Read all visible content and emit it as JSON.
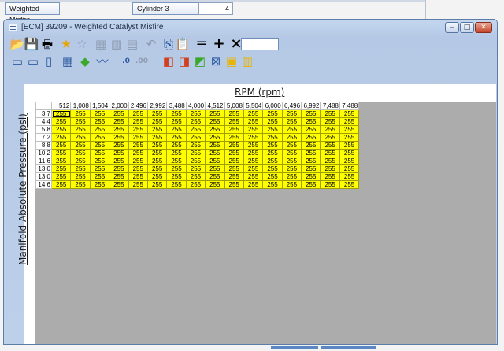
{
  "background": {
    "button_label": "Weighted Misfire",
    "cylinder_label": "Cylinder 3",
    "cylinder_value": "4"
  },
  "window": {
    "title": "[ECM] 39209 - Weighted Catalyst Misfire",
    "controls": {
      "minimize": "–",
      "maximize": "□",
      "close": "✕"
    }
  },
  "toolbar1": [
    {
      "name": "open-icon",
      "glyph": "📂",
      "disabled": true
    },
    {
      "name": "save-icon",
      "glyph": "💾",
      "disabled": true
    },
    {
      "name": "print-icon",
      "glyph": "🖶",
      "disabled": false
    },
    {
      "name": "add-favorite-icon",
      "glyph": "★",
      "disabled": false,
      "color": "#e8a400"
    },
    {
      "name": "remove-favorite-icon",
      "glyph": "☆",
      "disabled": true
    },
    {
      "name": "grid-select-icon",
      "glyph": "▦",
      "disabled": true
    },
    {
      "name": "grid-columns-icon",
      "glyph": "▥",
      "disabled": true
    },
    {
      "name": "grid-rows-icon",
      "glyph": "▤",
      "disabled": true
    },
    {
      "name": "undo-icon",
      "glyph": "↶",
      "disabled": true
    },
    {
      "name": "copy-icon",
      "glyph": "⎘",
      "disabled": false,
      "color": "#2c5aa0"
    },
    {
      "name": "paste-icon",
      "glyph": "📋",
      "disabled": false
    },
    {
      "name": "set-equal-icon",
      "glyph": "═",
      "disabled": false
    },
    {
      "name": "add-icon",
      "glyph": "+",
      "disabled": false
    },
    {
      "name": "multiply-icon",
      "glyph": "×",
      "disabled": false
    }
  ],
  "operation_value": "",
  "toolbar2": [
    {
      "name": "view-table-icon",
      "glyph": "▭",
      "disabled": false,
      "color": "#2c5aa0"
    },
    {
      "name": "view-split-icon",
      "glyph": "▭",
      "disabled": false,
      "color": "#2c5aa0"
    },
    {
      "name": "view-columns-icon",
      "glyph": "▯",
      "disabled": false,
      "color": "#2c5aa0"
    },
    {
      "name": "view-grid-icon",
      "glyph": "▦",
      "disabled": false,
      "color": "#2c5aa0"
    },
    {
      "name": "color-map-icon",
      "glyph": "◆",
      "disabled": false,
      "color": "#3aa82a"
    },
    {
      "name": "graph-icon",
      "glyph": "〰",
      "disabled": false,
      "color": "#2c5aa0"
    },
    {
      "name": "increase-decimals-icon",
      "glyph": ".0",
      "disabled": false,
      "color": "#2c5aa0"
    },
    {
      "name": "decrease-decimals-icon",
      "glyph": ".00",
      "disabled": true
    },
    {
      "name": "interpolate-horizontal-icon",
      "glyph": "◧",
      "disabled": false,
      "color": "#d04020"
    },
    {
      "name": "interpolate-vertical-icon",
      "glyph": "◨",
      "disabled": false,
      "color": "#d04020"
    },
    {
      "name": "interpolate-both-icon",
      "glyph": "◩",
      "disabled": false,
      "color": "#3aa82a"
    },
    {
      "name": "smooth-icon",
      "glyph": "⊠",
      "disabled": false,
      "color": "#2c5aa0"
    },
    {
      "name": "fill-icon",
      "glyph": "▣",
      "disabled": false,
      "color": "#e8b400"
    },
    {
      "name": "scale-icon",
      "glyph": "▥",
      "disabled": false,
      "color": "#e8b400"
    }
  ],
  "table": {
    "x_axis_label": "RPM (rpm)",
    "y_axis_label": "Manifold Absolute Pressure (psi)",
    "columns": [
      "512",
      "1,008",
      "1,504",
      "2,000",
      "2,496",
      "2,992",
      "3,488",
      "4,000",
      "4,512",
      "5,008",
      "5,504",
      "6,000",
      "6,496",
      "6,992",
      "7,488",
      "7,488"
    ],
    "rows": [
      "3.7",
      "4.4",
      "5.8",
      "7.2",
      "8.8",
      "10.2",
      "11.6",
      "13.0",
      "13.0",
      "14.6"
    ],
    "cell_value": "255",
    "cell_color": "#ffff00"
  }
}
